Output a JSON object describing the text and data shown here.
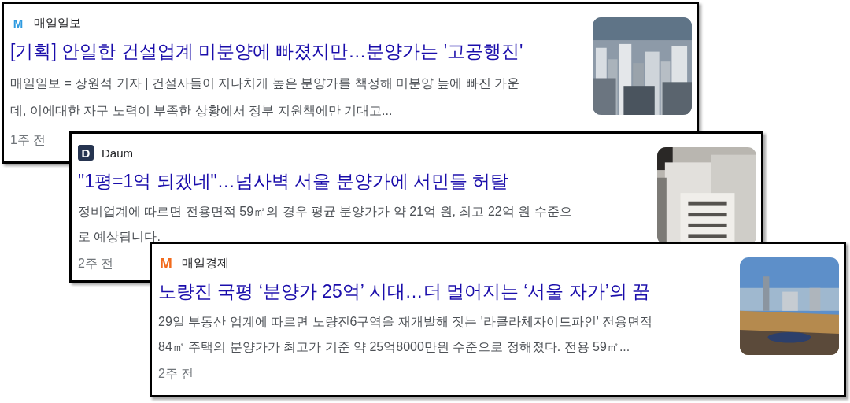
{
  "cards": [
    {
      "source": "매일일보",
      "logo": {
        "letter": "M",
        "color": "#2f9be0"
      },
      "title": "[기획] 안일한 건설업계 미분양에 빠졌지만…분양가는 '고공행진'",
      "description_lines": [
        "매일일보 = 장원석 기자 | 건설사들이 지나치게 높은 분양가를 책정해 미분양 늪에 빠진 가운",
        "데, 이에대한 자구 노력이 부족한 상황에서 정부 지원책에만 기대고..."
      ],
      "time": "1주 전",
      "thumbnail": {
        "kind": "picture"
      }
    },
    {
      "source": "Daum",
      "logo": {
        "letter": "D",
        "color": "#263450"
      },
      "title": "\"1평=1억 되겠네\"…넘사벽 서울 분양가에 서민들 허탈",
      "description_lines": [
        "정비업계에 따르면 전용면적 59㎡의 경우 평균 분양가가 약 21억 원, 최고 22억 원 수준으",
        "로 예상됩니다."
      ],
      "time": "2주 전",
      "thumbnail": {
        "kind": "picture"
      }
    },
    {
      "source": "매일경제",
      "logo": {
        "letter": "M",
        "color": "#f26b1d"
      },
      "title": "노량진 국평 ‘분양가 25억’ 시대…더 멀어지는 ‘서울 자가’의 꿈",
      "description_lines": [
        "29일 부동산 업계에 따르면 노량진6구역을 재개발해 짓는 '라클라체자이드파인' 전용면적",
        "84㎡ 주택의 분양가가 최고가 기준 약 25억8000만원 수준으로 정해졌다. 전용 59㎡..."
      ],
      "time": "2주 전",
      "thumbnail": {
        "kind": "picture"
      }
    }
  ]
}
